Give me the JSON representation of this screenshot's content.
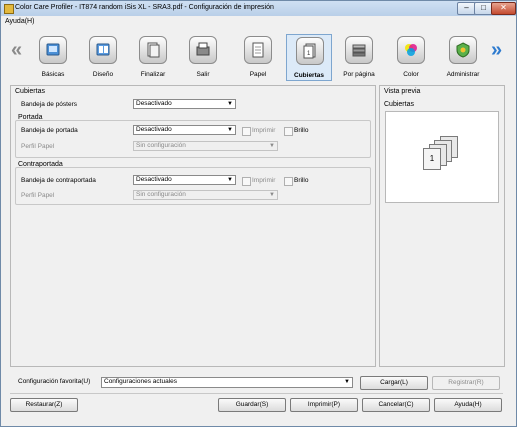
{
  "window": {
    "title": "Color Care Profiler - IT874 random iSis XL - SRA3.pdf - Configuración de impresión",
    "min_label": "–",
    "max_label": "□",
    "close_label": "✕"
  },
  "menu": {
    "help": "Ayuda(H)"
  },
  "toolbar": {
    "prev_label": "«",
    "next_label": "»",
    "items": [
      {
        "label": "Básicas",
        "icon": "basic-settings-icon"
      },
      {
        "label": "Diseño",
        "icon": "layout-icon"
      },
      {
        "label": "Finalizar",
        "icon": "finishing-icon"
      },
      {
        "label": "Salir",
        "icon": "output-icon"
      },
      {
        "label": "Papel",
        "icon": "paper-icon"
      },
      {
        "label": "Cubiertas",
        "icon": "covers-icon",
        "selected": true
      },
      {
        "label": "Por página",
        "icon": "per-page-icon"
      },
      {
        "label": "Color",
        "icon": "color-icon"
      },
      {
        "label": "Administrar",
        "icon": "admin-icon"
      }
    ]
  },
  "covers": {
    "title": "Cubiertas",
    "poster_tray_label": "Bandeja de pósters",
    "poster_tray_value": "Desactivado",
    "front": {
      "title": "Portada",
      "tray_label": "Bandeja de portada",
      "tray_value": "Desactivado",
      "print_label": "Imprimir",
      "gloss_label": "Brillo",
      "profile_label": "Perfil Papel",
      "profile_value": "Sin configuración"
    },
    "back": {
      "title": "Contraportada",
      "tray_label": "Bandeja de contraportada",
      "tray_value": "Desactivado",
      "print_label": "Imprimir",
      "gloss_label": "Brillo",
      "profile_label": "Perfil Papel",
      "profile_value": "Sin configuración"
    }
  },
  "preview": {
    "title": "Vista previa",
    "subtitle": "Cubiertas",
    "sheets": [
      "1",
      "2",
      "n"
    ]
  },
  "favorites": {
    "label": "Configuración favorita(U)",
    "value": "Configuraciones actuales",
    "load_label": "Cargar(L)",
    "register_label": "Registrar(R)"
  },
  "buttons": {
    "restore": "Restaurar(Z)",
    "save": "Guardar(S)",
    "print": "Imprimir(P)",
    "cancel": "Cancelar(C)",
    "help": "Ayuda(H)"
  },
  "colors": {
    "accent": "#2e7bcf",
    "selected_bg": "#dceaf8"
  }
}
